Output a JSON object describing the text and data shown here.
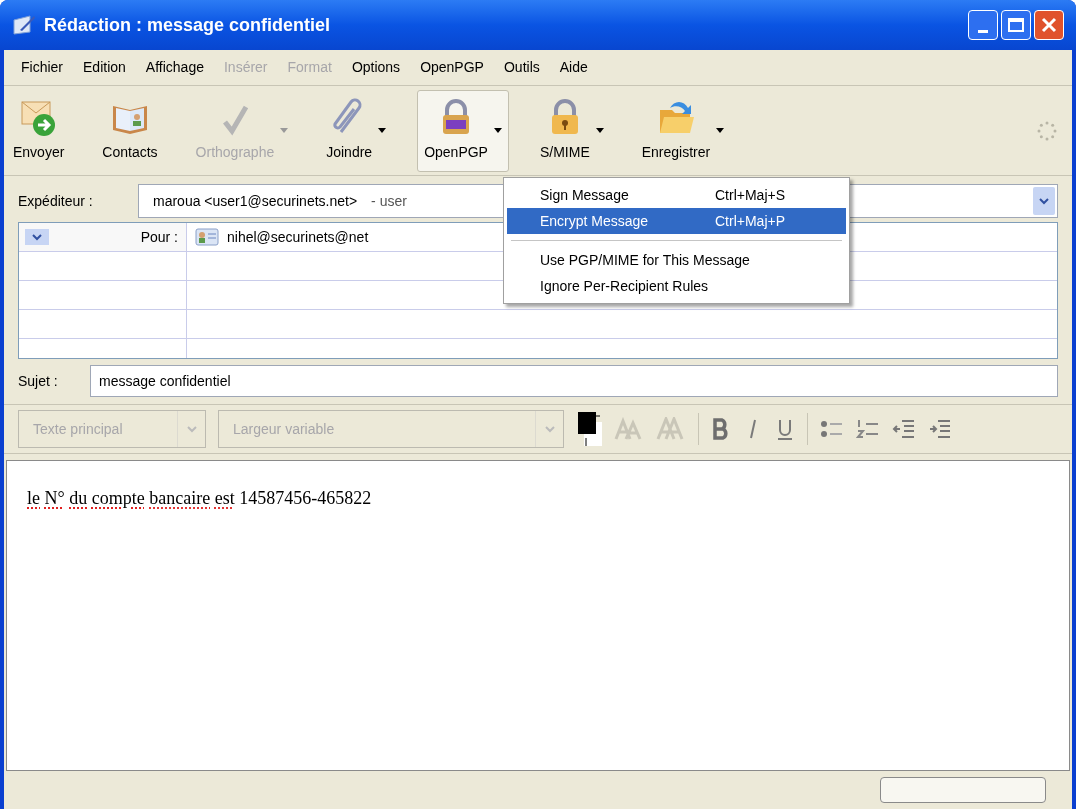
{
  "window": {
    "title": "Rédaction : message confidentiel"
  },
  "menu_bar": [
    {
      "label": "Fichier",
      "disabled": false
    },
    {
      "label": "Edition",
      "disabled": false
    },
    {
      "label": "Affichage",
      "disabled": false
    },
    {
      "label": "Insérer",
      "disabled": true
    },
    {
      "label": "Format",
      "disabled": true
    },
    {
      "label": "Options",
      "disabled": false
    },
    {
      "label": "OpenPGP",
      "disabled": false
    },
    {
      "label": "Outils",
      "disabled": false
    },
    {
      "label": "Aide",
      "disabled": false
    }
  ],
  "toolbar": [
    {
      "kind": "send",
      "label": "Envoyer",
      "disabled": false,
      "pressed": false,
      "has_dropdown": false
    },
    {
      "kind": "contacts",
      "label": "Contacts",
      "disabled": false,
      "pressed": false,
      "has_dropdown": false
    },
    {
      "kind": "spelling",
      "label": "Orthographe",
      "disabled": true,
      "pressed": false,
      "has_dropdown": true
    },
    {
      "kind": "attach",
      "label": "Joindre",
      "disabled": false,
      "pressed": false,
      "has_dropdown": true
    },
    {
      "kind": "pgp",
      "label": "OpenPGP",
      "disabled": false,
      "pressed": true,
      "has_dropdown": true
    },
    {
      "kind": "lock",
      "label": "S/MIME",
      "disabled": false,
      "pressed": false,
      "has_dropdown": true
    },
    {
      "kind": "save",
      "label": "Enregistrer",
      "disabled": false,
      "pressed": false,
      "has_dropdown": true
    }
  ],
  "sender": {
    "label": "Expéditeur :",
    "value": "maroua <user1@securinets.net>",
    "extra": "- user"
  },
  "recipients": [
    {
      "type": "Pour :",
      "address": "nihel@securinets@net"
    }
  ],
  "subject": {
    "label": "Sujet :",
    "value": "message confidentiel"
  },
  "format_bar": {
    "paragraph_style": "Texte principal",
    "font": "Largeur variable"
  },
  "body": {
    "words": [
      {
        "text": "le",
        "misspelled": true
      },
      {
        "text": "N°",
        "misspelled": true
      },
      {
        "text": "du",
        "misspelled": true
      },
      {
        "text": "compte",
        "misspelled": true
      },
      {
        "text": "bancaire",
        "misspelled": true
      },
      {
        "text": "est",
        "misspelled": true
      },
      {
        "text": "14587456-465822",
        "misspelled": false
      }
    ]
  },
  "openpgp_menu": [
    {
      "kind": "item",
      "label": "Sign Message",
      "shortcut": "Ctrl+Maj+S",
      "selected": false
    },
    {
      "kind": "item",
      "label": "Encrypt Message",
      "shortcut": "Ctrl+Maj+P",
      "selected": true
    },
    {
      "kind": "separator"
    },
    {
      "kind": "item",
      "label": "Use PGP/MIME for This Message",
      "selected": false
    },
    {
      "kind": "item",
      "label": "Ignore Per-Recipient Rules",
      "selected": false
    }
  ]
}
